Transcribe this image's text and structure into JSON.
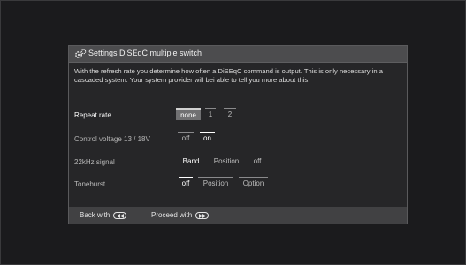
{
  "dialog": {
    "title": "Settings DiSEqC multiple switch",
    "title_icon": "gears-icon",
    "description": "With the refresh rate you determine how often a DiSEqC command is output. This is only necessary in a cascaded system. Your system provider will bei able to tell you more about this."
  },
  "settings": [
    {
      "label": "Repeat rate",
      "options": [
        "none",
        "1",
        "2"
      ],
      "selected": "none",
      "focused": true
    },
    {
      "label": "Control voltage 13 / 18V",
      "options": [
        "off",
        "on"
      ],
      "selected": "on",
      "focused": false
    },
    {
      "label": "22kHz signal",
      "options": [
        "Band",
        "Position",
        "off"
      ],
      "selected": "Band",
      "focused": false
    },
    {
      "label": "Toneburst",
      "options": [
        "off",
        "Position",
        "Option"
      ],
      "selected": "off",
      "focused": false
    }
  ],
  "footer": {
    "back_label": "Back with",
    "back_key_icon": "rewind-key-icon",
    "proceed_label": "Proceed with",
    "proceed_key_icon": "forward-key-icon"
  },
  "colors": {
    "background": "#1b1b1d",
    "dialog": "#414143",
    "body": "#262628",
    "focus_highlight": "#707072"
  }
}
